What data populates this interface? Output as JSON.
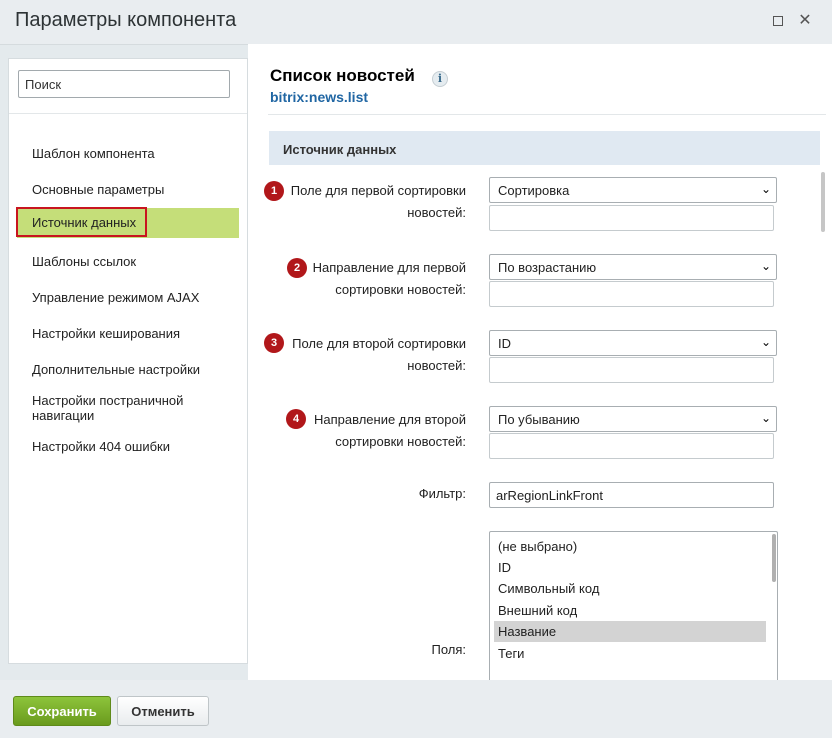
{
  "window": {
    "title": "Параметры компонента"
  },
  "sidebar": {
    "search_placeholder": "Поиск",
    "items": [
      {
        "label": "Шаблон компонента"
      },
      {
        "label": "Основные параметры"
      },
      {
        "label": "Источник данных"
      },
      {
        "label": "Шаблоны ссылок"
      },
      {
        "label": "Управление режимом AJAX"
      },
      {
        "label": "Настройки кеширования"
      },
      {
        "label": "Дополнительные настройки"
      },
      {
        "label": "Настройки постраничной навигации"
      },
      {
        "label": "Настройки 404 ошибки"
      }
    ],
    "active_index": 2
  },
  "component": {
    "title": "Список новостей",
    "code": "bitrix:news.list"
  },
  "section": {
    "title": "Источник данных"
  },
  "fields": [
    {
      "badge": "1",
      "label_line1": "Поле для первой сортировки",
      "label_line2": "новостей:",
      "value": "Сортировка"
    },
    {
      "badge": "2",
      "label_line1": "Направление для первой",
      "label_line2": "сортировки новостей:",
      "value": "По возрастанию"
    },
    {
      "badge": "3",
      "label_line1": "Поле для второй сортировки",
      "label_line2": "новостей:",
      "value": "ID"
    },
    {
      "badge": "4",
      "label_line1": "Направление для второй",
      "label_line2": "сортировки новостей:",
      "value": "По убыванию"
    }
  ],
  "filter": {
    "label": "Фильтр:",
    "value": "arRegionLinkFront"
  },
  "fields_list": {
    "label": "Поля:",
    "options": [
      "(не выбрано)",
      "ID",
      "Символьный код",
      "Внешний код",
      "Название",
      "Теги"
    ],
    "selected": "Название"
  },
  "footer": {
    "save_label": "Сохранить",
    "cancel_label": "Отменить"
  },
  "icons": {
    "maximize": "maximize-icon",
    "close": "close-icon",
    "info": "info-icon",
    "dropdown": "chevron-down-icon"
  },
  "colors": {
    "active_item": "#c5de79",
    "highlight_border": "#c8151f",
    "badge": "#b1171a",
    "save_button": "#7cb02c",
    "link": "#2066a3"
  }
}
